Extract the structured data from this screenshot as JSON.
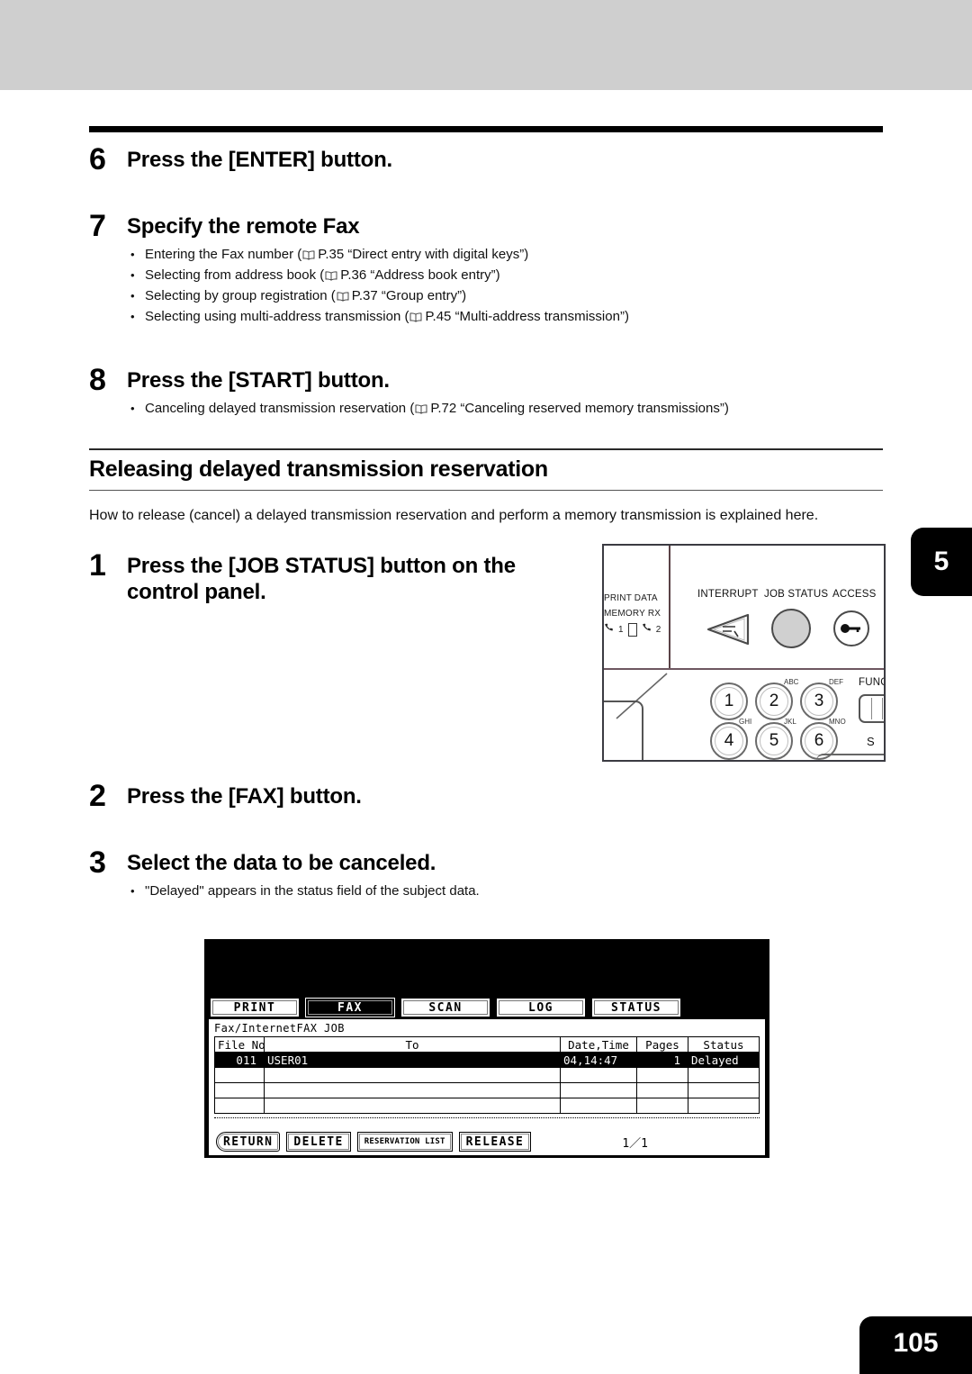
{
  "page": {
    "chapter_tab": "5",
    "page_number": "105"
  },
  "steps_top": [
    {
      "num": "6",
      "title": "Press the [ENTER] button.",
      "bullets": []
    },
    {
      "num": "7",
      "title": "Specify the remote Fax",
      "bullets": [
        {
          "pre": "Entering the Fax number (",
          "page_ref": "P.35",
          "quote": "“Direct entry with digital keys”",
          "post": ")"
        },
        {
          "pre": "Selecting from address book (",
          "page_ref": "P.36",
          "quote": "“Address book entry”",
          "post": ")"
        },
        {
          "pre": "Selecting by group registration (",
          "page_ref": "P.37",
          "quote": "“Group entry”",
          "post": ")"
        },
        {
          "pre": "Selecting using multi-address transmission (",
          "page_ref": "P.45",
          "quote": "“Multi-address transmission”",
          "post": ")"
        }
      ]
    },
    {
      "num": "8",
      "title": "Press the [START] button.",
      "bullets": [
        {
          "pre": "Canceling delayed transmission reservation (",
          "page_ref": "P.72",
          "quote": "“Canceling reserved memory transmissions”",
          "post": ")"
        }
      ]
    }
  ],
  "section": {
    "heading": "Releasing delayed transmission reservation",
    "lead": "How to release (cancel) a delayed transmission reservation and perform a memory transmission is explained here."
  },
  "steps_bottom": [
    {
      "num": "1",
      "title": "Press the [JOB STATUS] button on the control panel."
    },
    {
      "num": "2",
      "title": "Press the [FAX] button."
    },
    {
      "num": "3",
      "title": "Select the data to be canceled.",
      "bullet": "\"Delayed\" appears in the status field of the subject data."
    }
  ],
  "control_panel": {
    "lamps": [
      "PRINT DATA",
      "MEMORY RX"
    ],
    "lamp_line3_left": "1",
    "lamp_line3_right": "2",
    "buttons": [
      {
        "label": "INTERRUPT"
      },
      {
        "label": "JOB STATUS"
      },
      {
        "label": "ACCESS"
      }
    ],
    "function_label": "FUNC",
    "stop_label": "S",
    "keypad": [
      {
        "digit": "1",
        "letters": ""
      },
      {
        "digit": "2",
        "letters": "ABC"
      },
      {
        "digit": "3",
        "letters": "DEF"
      },
      {
        "digit": "4",
        "letters": "GHI"
      },
      {
        "digit": "5",
        "letters": "JKL"
      },
      {
        "digit": "6",
        "letters": "MNO"
      }
    ]
  },
  "lcd": {
    "tabs": [
      {
        "label": "PRINT",
        "active": false
      },
      {
        "label": "FAX",
        "active": true
      },
      {
        "label": "SCAN",
        "active": false
      },
      {
        "label": "LOG",
        "active": false
      },
      {
        "label": "STATUS",
        "active": false
      }
    ],
    "job_title": "Fax/InternetFAX JOB",
    "columns": [
      "File No.",
      "To",
      "Date,Time",
      "Pages",
      "Status"
    ],
    "rows": [
      {
        "file_no": "011",
        "to": "USER01",
        "date_time": "04,14:47",
        "pages": "1",
        "status": "Delayed",
        "selected": true
      }
    ],
    "empty_row_count": 3,
    "buttons": [
      {
        "label": "RETURN",
        "style": "ret"
      },
      {
        "label": "DELETE",
        "style": ""
      },
      {
        "label": "RESERVATION LIST",
        "style": "small"
      },
      {
        "label": "RELEASE",
        "style": ""
      }
    ],
    "page_indicator": "1／1"
  },
  "colors": {
    "band": "#cfcfcf",
    "ink": "#000000",
    "tab_bg": "#000000",
    "highlight": "#000000"
  }
}
